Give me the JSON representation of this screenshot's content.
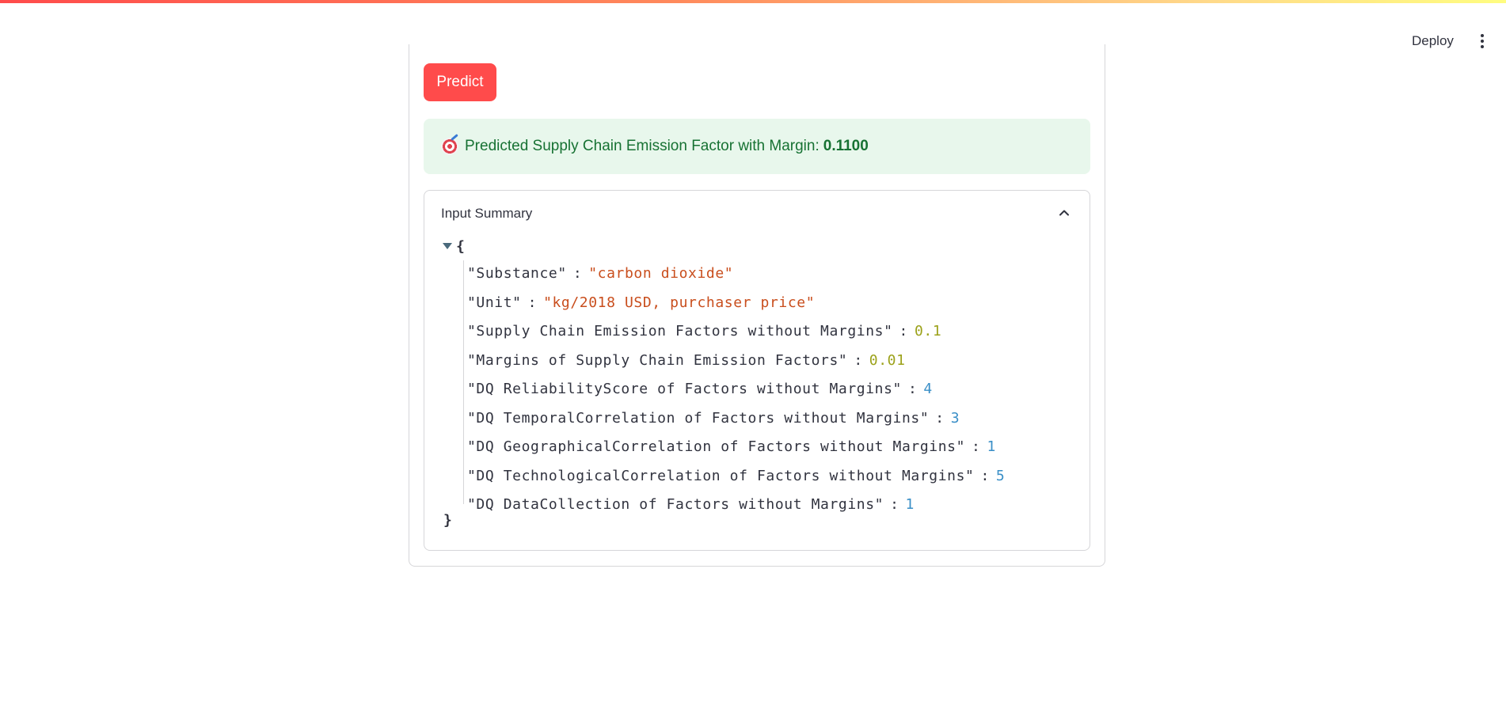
{
  "header": {
    "deploy_label": "Deploy",
    "menu_icon": "vertical-ellipsis-icon"
  },
  "predict_button": {
    "label": "Predict"
  },
  "result": {
    "icon": "target-icon",
    "label": "Predicted Supply Chain Emission Factor with Margin:",
    "value": "0.1100"
  },
  "input_summary": {
    "title": "Input Summary",
    "expanded": true,
    "json_open": "{",
    "json_close": "}",
    "entries": [
      {
        "key": "\"Substance\"",
        "value": "\"carbon dioxide\"",
        "type": "string"
      },
      {
        "key": "\"Unit\"",
        "value": "\"kg/2018 USD, purchaser price\"",
        "type": "string"
      },
      {
        "key": "\"Supply Chain Emission Factors without Margins\"",
        "value": "0.1",
        "type": "float"
      },
      {
        "key": "\"Margins of Supply Chain Emission Factors\"",
        "value": "0.01",
        "type": "float"
      },
      {
        "key": "\"DQ ReliabilityScore of Factors without Margins\"",
        "value": "4",
        "type": "int"
      },
      {
        "key": "\"DQ TemporalCorrelation of Factors without Margins\"",
        "value": "3",
        "type": "int"
      },
      {
        "key": "\"DQ GeographicalCorrelation of Factors without Margins\"",
        "value": "1",
        "type": "int"
      },
      {
        "key": "\"DQ TechnologicalCorrelation of Factors without Margins\"",
        "value": "5",
        "type": "int"
      },
      {
        "key": "\"DQ DataCollection of Factors without Margins\"",
        "value": "1",
        "type": "int"
      }
    ]
  },
  "colors": {
    "primary": "#ff4b4b",
    "success_bg": "#e8f7ec",
    "success_text": "#177233",
    "json_string": "#c94e1d",
    "json_float": "#9ca21b",
    "json_int": "#3a8fc7"
  }
}
